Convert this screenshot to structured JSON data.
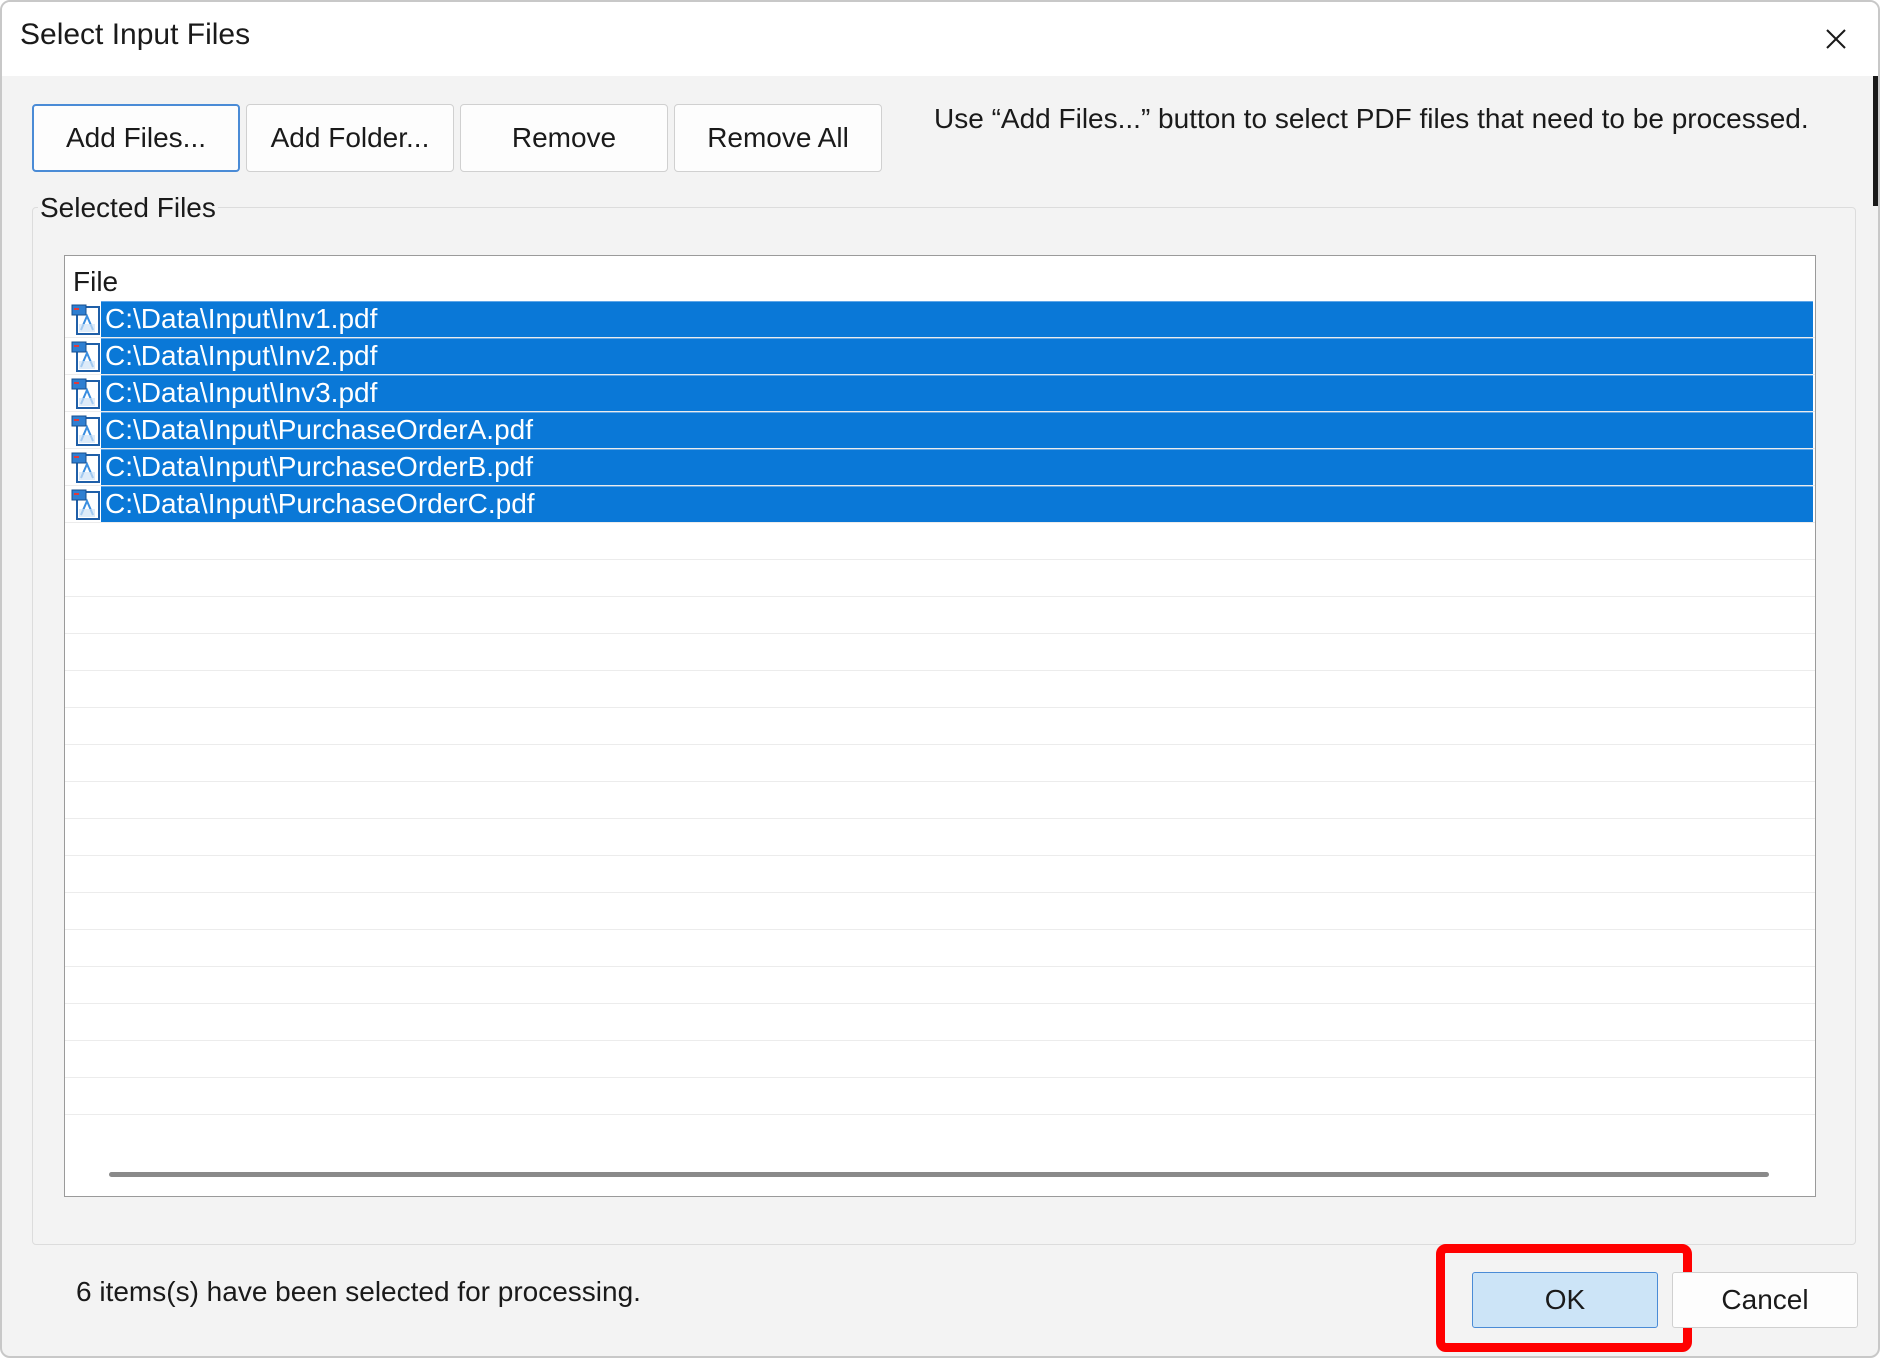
{
  "window": {
    "title": "Select Input Files",
    "close_icon": "close-icon"
  },
  "toolbar": {
    "add_files_label": "Add Files...",
    "add_folder_label": "Add Folder...",
    "remove_label": "Remove",
    "remove_all_label": "Remove All",
    "hint": "Use “Add Files...” button to select PDF files that need to be processed."
  },
  "selected_files": {
    "group_label": "Selected Files",
    "column_header": "File",
    "file_icon": "pdf-file-icon",
    "files": [
      "C:\\Data\\Input\\Inv1.pdf",
      "C:\\Data\\Input\\Inv2.pdf",
      "C:\\Data\\Input\\Inv3.pdf",
      "C:\\Data\\Input\\PurchaseOrderA.pdf",
      "C:\\Data\\Input\\PurchaseOrderB.pdf",
      "C:\\Data\\Input\\PurchaseOrderC.pdf"
    ]
  },
  "footer": {
    "status": "6 items(s) have been selected for processing.",
    "ok_label": "OK",
    "cancel_label": "Cancel"
  },
  "colors": {
    "selection": "#0a78d7",
    "highlight_annotation": "#ff0000",
    "ok_button_bg": "#cce4f7"
  }
}
